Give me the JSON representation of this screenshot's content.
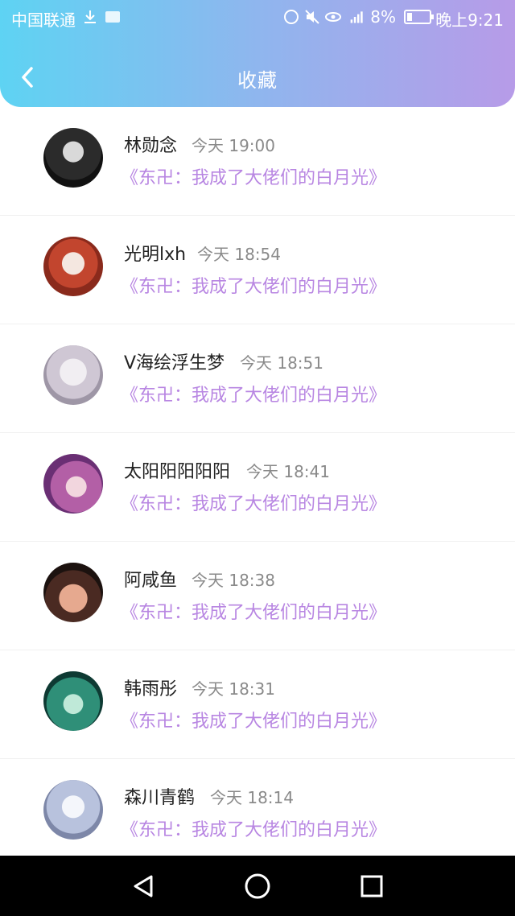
{
  "statusbar": {
    "carrier": "中国联通",
    "battery": "8%",
    "time": "晚上9:21"
  },
  "header": {
    "title": "收藏"
  },
  "items": [
    {
      "name": "林勋念",
      "time": "今天 19:00",
      "work": "《东卍：我成了大佬们的白月光》"
    },
    {
      "name": "光明lxh",
      "time": "今天 18:54",
      "work": "《东卍：我成了大佬们的白月光》"
    },
    {
      "name": "V海绘浮生梦",
      "time": "今天 18:51",
      "work": "《东卍：我成了大佬们的白月光》"
    },
    {
      "name": "太阳阳阳阳阳",
      "time": "今天 18:41",
      "work": "《东卍：我成了大佬们的白月光》"
    },
    {
      "name": "阿咸鱼",
      "time": "今天 18:38",
      "work": "《东卍：我成了大佬们的白月光》"
    },
    {
      "name": "韩雨彤",
      "time": "今天 18:31",
      "work": "《东卍：我成了大佬们的白月光》"
    },
    {
      "name": "森川青鹤",
      "time": "今天 18:14",
      "work": "《东卍：我成了大佬们的白月光》"
    }
  ],
  "colors": {
    "accent": "#b886e2",
    "header_start": "#5ed3f3",
    "header_end": "#b79be8"
  }
}
